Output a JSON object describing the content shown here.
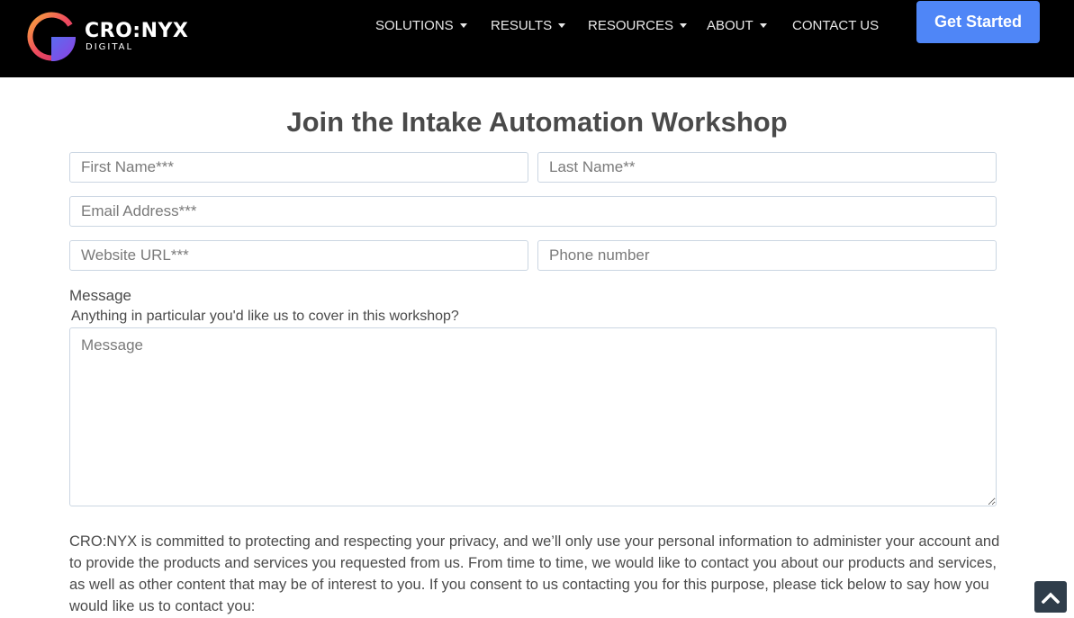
{
  "header": {
    "brand_name": "CRO:NYX",
    "brand_sub": "DIGITAL",
    "nav": [
      {
        "label": "SOLUTIONS",
        "dropdown": true
      },
      {
        "label": "RESULTS",
        "dropdown": true
      },
      {
        "label": "RESOURCES",
        "dropdown": true
      },
      {
        "label": "ABOUT",
        "dropdown": true
      },
      {
        "label": "CONTACT US",
        "dropdown": false
      }
    ],
    "cta_label": "Get Started"
  },
  "form": {
    "title": "Join the Intake Automation Workshop",
    "first_name_placeholder": "First Name***",
    "last_name_placeholder": "Last Name**",
    "email_placeholder": "Email Address***",
    "website_placeholder": "Website URL***",
    "phone_placeholder": "Phone number",
    "message_label": "Message",
    "message_help": "Anything in particular you'd like us to cover in this workshop?",
    "message_placeholder": "Message",
    "privacy_text": "CRO:NYX is committed to protecting and respecting your privacy, and we’ll only use your personal information to administer your account and to provide the products and services you requested from us. From time to time, we would like to contact you about our products and services, as well as other content that may be of interest to you. If you consent to us contacting you for this purpose, please tick below to say how you would like us to contact you:"
  },
  "colors": {
    "header_bg": "#000000",
    "cta_bg": "#4f86f7",
    "scroll_top_bg": "#2f3d4a"
  },
  "icons": {
    "logo": "cronyx-logo-icon",
    "scroll_top": "chevron-up-icon"
  }
}
